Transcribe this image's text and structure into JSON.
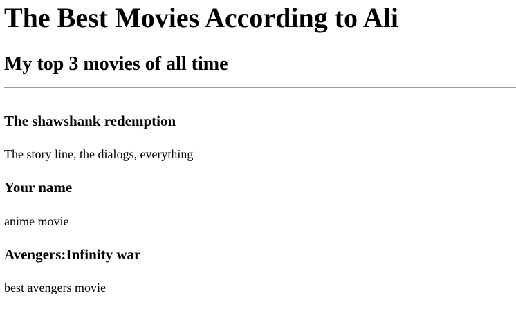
{
  "page": {
    "title": "The Best Movies According to Ali",
    "subtitle": "My top 3 movies of all time"
  },
  "movies": [
    {
      "title": "The shawshank redemption",
      "description": "The story line, the dialogs, everything"
    },
    {
      "title": "Your name",
      "description": "anime movie"
    },
    {
      "title": "Avengers:Infinity war",
      "description": "best avengers movie"
    }
  ]
}
